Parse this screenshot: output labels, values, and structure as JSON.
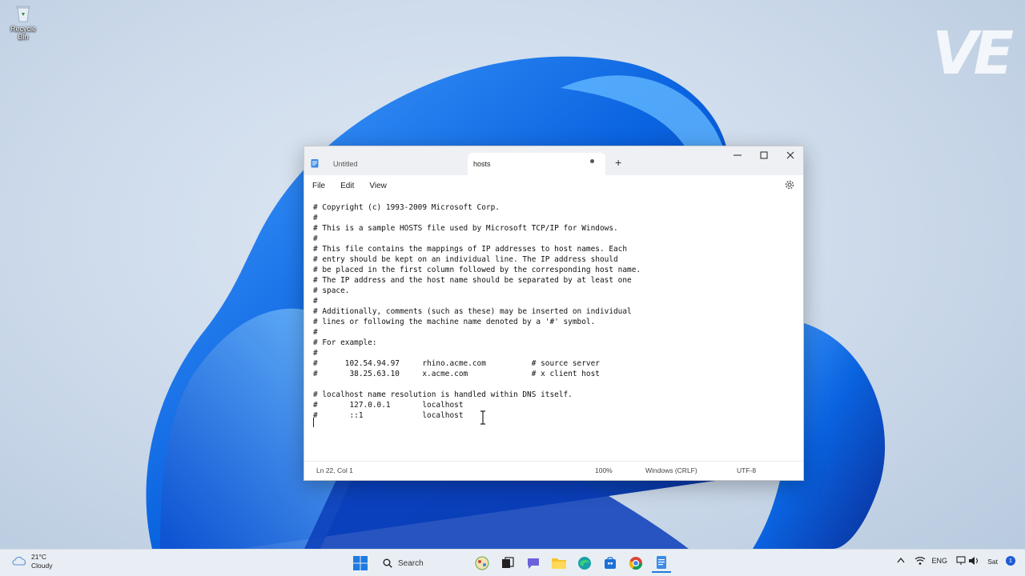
{
  "desktop": {
    "recycle_bin_label": "Recycle Bin",
    "watermark": "VE"
  },
  "window": {
    "tabs": [
      {
        "label": "Untitled"
      },
      {
        "label": "hosts"
      }
    ],
    "menu": [
      "File",
      "Edit",
      "View"
    ],
    "content": "# Copyright (c) 1993-2009 Microsoft Corp.\n#\n# This is a sample HOSTS file used by Microsoft TCP/IP for Windows.\n#\n# This file contains the mappings of IP addresses to host names. Each\n# entry should be kept on an individual line. The IP address should\n# be placed in the first column followed by the corresponding host name.\n# The IP address and the host name should be separated by at least one\n# space.\n#\n# Additionally, comments (such as these) may be inserted on individual\n# lines or following the machine name denoted by a '#' symbol.\n#\n# For example:\n#\n#      102.54.94.97     rhino.acme.com          # source server\n#       38.25.63.10     x.acme.com              # x client host\n\n# localhost name resolution is handled within DNS itself.\n#\t127.0.0.1       localhost\n#\t::1             localhost\n",
    "status": {
      "position": "Ln 22, Col 1",
      "zoom": "100%",
      "line_ending": "Windows (CRLF)",
      "encoding": "UTF-8"
    }
  },
  "taskbar": {
    "weather_temp": "21°C",
    "weather_desc": "Cloudy",
    "search_label": "Search",
    "language": "ENG",
    "day": "Sat",
    "notification_count": "1"
  }
}
